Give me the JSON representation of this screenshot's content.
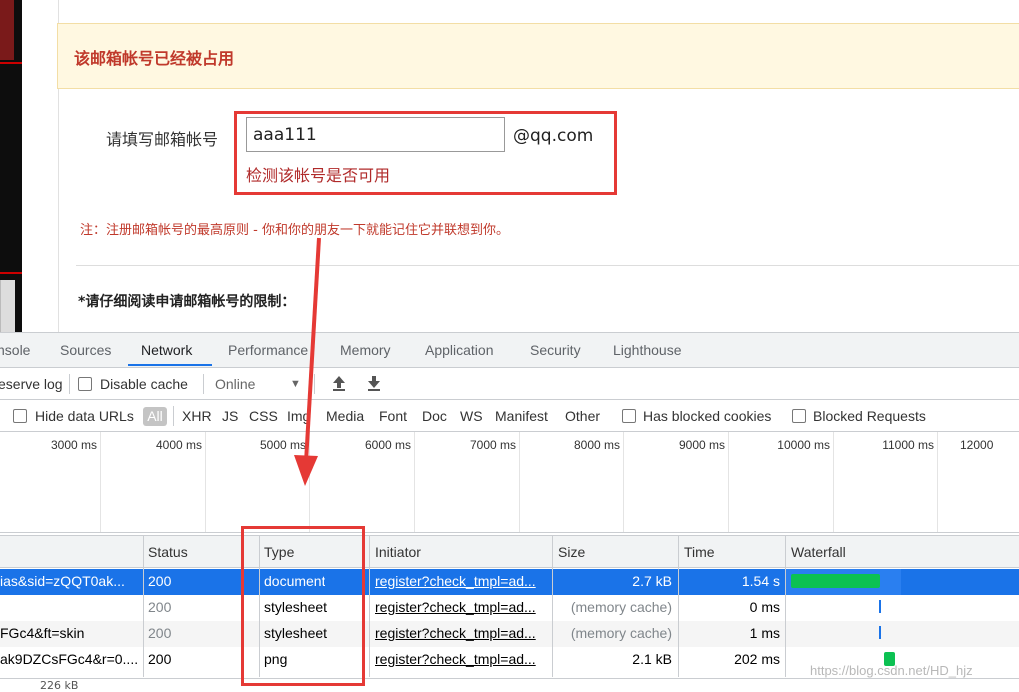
{
  "page": {
    "warning": "该邮箱帐号已经被占用",
    "field_label": "请填写邮箱帐号",
    "email_value": "aaa111",
    "email_suffix": "@qq.com",
    "check_text": "检测该帐号是否可用",
    "note": "注：注册邮箱帐号的最高原则 - 你和你的朋友一下就能记住它并联想到你。",
    "rules_heading": "*请仔细阅读申请邮箱帐号的限制："
  },
  "devtools": {
    "tabs": [
      "nsole",
      "Sources",
      "Network",
      "Performance",
      "Memory",
      "Application",
      "Security",
      "Lighthouse"
    ],
    "active_tab": "Network",
    "toolbar": {
      "preserve_log": "eserve log",
      "disable_cache": "Disable cache",
      "throttle": "Online"
    },
    "filters": {
      "hide_data_urls": "Hide data URLs",
      "all": "All",
      "types": [
        "XHR",
        "JS",
        "CSS",
        "Img",
        "Media",
        "Font",
        "Doc",
        "WS",
        "Manifest",
        "Other"
      ],
      "has_blocked_cookies": "Has blocked cookies",
      "blocked_requests": "Blocked Requests"
    },
    "timeline_labels": [
      "3000 ms",
      "4000 ms",
      "5000 ms",
      "6000 ms",
      "7000 ms",
      "8000 ms",
      "9000 ms",
      "10000 ms",
      "11000 ms",
      "12000"
    ],
    "columns": {
      "status": "Status",
      "type": "Type",
      "initiator": "Initiator",
      "size": "Size",
      "time": "Time",
      "waterfall": "Waterfall"
    },
    "rows": [
      {
        "name": "ias&sid=zQQT0ak...",
        "status": "200",
        "type": "document",
        "initiator": "register?check_tmpl=ad...",
        "size": "2.7 kB",
        "time": "1.54 s"
      },
      {
        "name": "",
        "status": "200",
        "type": "stylesheet",
        "initiator": "register?check_tmpl=ad...",
        "size": "(memory cache)",
        "time": "0 ms"
      },
      {
        "name": "FGc4&ft=skin",
        "status": "200",
        "type": "stylesheet",
        "initiator": "register?check_tmpl=ad...",
        "size": "(memory cache)",
        "time": "1 ms"
      },
      {
        "name": "ak9DZCsFGc4&r=0....",
        "status": "200",
        "type": "png",
        "initiator": "register?check_tmpl=ad...",
        "size": "2.1 kB",
        "time": "202 ms"
      }
    ],
    "footer": "226 kB"
  },
  "watermark": "https://blog.csdn.net/HD_hjz",
  "colors": {
    "accent": "#1a73e8",
    "annotation": "#e53935",
    "waterfall_green": "#0cc152"
  },
  "icons": {
    "upload": "upload-arrow-icon",
    "download": "download-arrow-icon",
    "dropdown": "caret-down-icon"
  }
}
